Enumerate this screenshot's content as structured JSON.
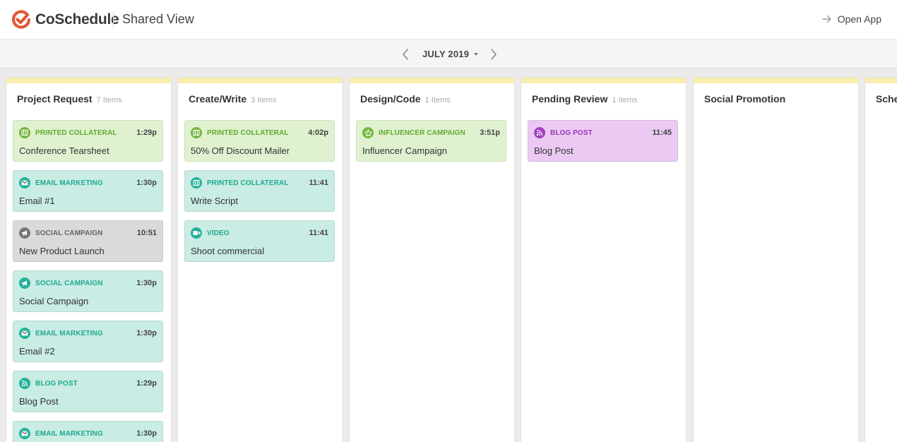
{
  "header": {
    "brand": "CoSchedule",
    "view_title": "Shared View",
    "open_app": "Open App",
    "accent": "#e05a3a"
  },
  "nav": {
    "month": "JULY 2019"
  },
  "columns": [
    {
      "title": "Project Request",
      "count": "7 Items",
      "cards": [
        {
          "type": "PRINTED COLLATERAL",
          "time": "1:29p",
          "title": "Conference Tearsheet",
          "color": "green",
          "icon": "map-icon"
        },
        {
          "type": "EMAIL MARKETING",
          "time": "1:30p",
          "title": "Email #1",
          "color": "teal",
          "icon": "envelope-icon"
        },
        {
          "type": "SOCIAL CAMPAIGN",
          "time": "10:51",
          "title": "New Product Launch",
          "color": "gray",
          "icon": "megaphone-icon"
        },
        {
          "type": "SOCIAL CAMPAIGN",
          "time": "1:30p",
          "title": "Social Campaign",
          "color": "teal",
          "icon": "megaphone-icon"
        },
        {
          "type": "EMAIL MARKETING",
          "time": "1:30p",
          "title": "Email #2",
          "color": "teal",
          "icon": "envelope-icon"
        },
        {
          "type": "BLOG POST",
          "time": "1:29p",
          "title": "Blog Post",
          "color": "teal",
          "icon": "rss-icon"
        },
        {
          "type": "EMAIL MARKETING",
          "time": "1:30p",
          "title": "",
          "color": "teal",
          "icon": "envelope-icon"
        }
      ]
    },
    {
      "title": "Create/Write",
      "count": "3 Items",
      "cards": [
        {
          "type": "PRINTED COLLATERAL",
          "time": "4:02p",
          "title": "50% Off Discount Mailer",
          "color": "green",
          "icon": "map-icon"
        },
        {
          "type": "PRINTED COLLATERAL",
          "time": "11:41",
          "title": "Write Script",
          "color": "teal",
          "icon": "map-icon"
        },
        {
          "type": "VIDEO",
          "time": "11:41",
          "title": "Shoot commercial",
          "color": "teal",
          "icon": "video-icon"
        }
      ]
    },
    {
      "title": "Design/Code",
      "count": "1 Items",
      "cards": [
        {
          "type": "INFLUENCER CAMPAIGN",
          "time": "3:51p",
          "title": "Influencer Campaign",
          "color": "green",
          "icon": "star-icon"
        }
      ]
    },
    {
      "title": "Pending Review",
      "count": "1 Items",
      "cards": [
        {
          "type": "BLOG POST",
          "time": "11:45",
          "title": "Blog Post",
          "color": "purple",
          "icon": "rss-icon"
        }
      ]
    },
    {
      "title": "Social Promotion",
      "count": "",
      "cards": []
    },
    {
      "title": "Sche",
      "count": "",
      "cards": []
    }
  ]
}
